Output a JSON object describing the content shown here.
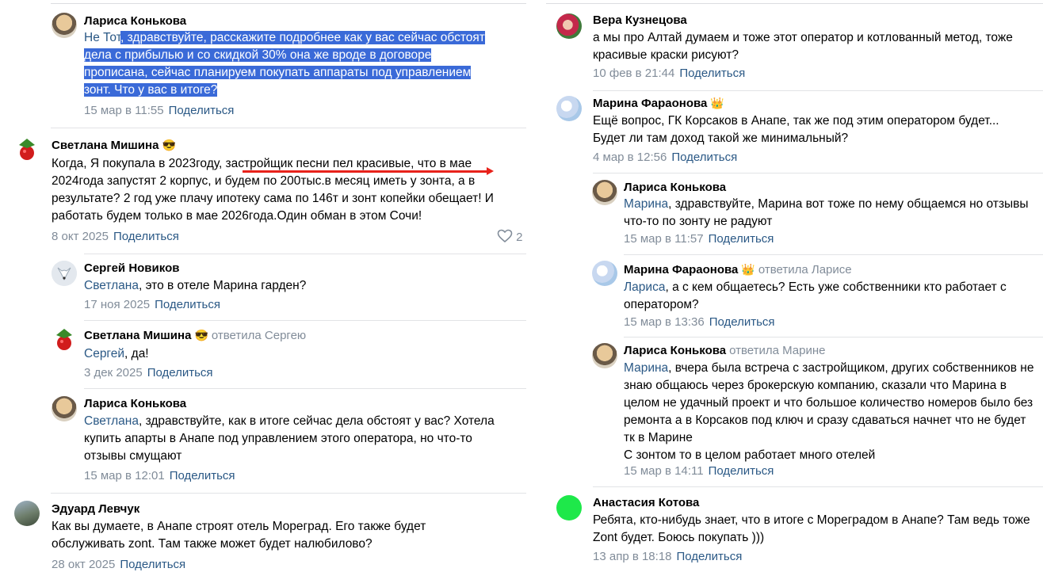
{
  "left": {
    "comments": [
      {
        "name": "Лариса Конькова",
        "mention": "Не Тот",
        "lines": [
          ", здравствуйте, расскажите подробнее как у вас сейчас обстоят",
          "дела с прибылью и со скидкой 30% она же вроде в договоре",
          "прописана, сейчас планируем покупать аппараты под управлением",
          "зонт. Что у вас в итоге?"
        ],
        "date": "15 мар в 11:55",
        "share": "Поделиться"
      },
      {
        "name": "Светлана Мишина",
        "emoji": "😎",
        "lines": [
          "Когда, Я покупала в 2023году, застройщик песни пел красивые, что в мае",
          "2024года запустят 2 корпус, и будем по 200тыс.в месяц иметь у зонта, а в",
          "результате? 2 год уже плачу ипотеку сама по 146т и зонт копейки обещает! И",
          "работать будем только в мае 2026года.Один обман в этом Сочи!"
        ],
        "date": "8 окт 2025",
        "share": "Поделиться",
        "likes": "2"
      },
      {
        "name": "Сергей Новиков",
        "mention": "Светлана",
        "lines": [
          ", это в отеле Марина гарден?"
        ],
        "date": "17 ноя 2025",
        "share": "Поделиться"
      },
      {
        "name": "Светлана Мишина",
        "emoji": "😎",
        "reply_to": "ответила Сергею",
        "mention": "Сергей",
        "lines": [
          ", да!"
        ],
        "date": "3 дек 2025",
        "share": "Поделиться"
      },
      {
        "name": "Лариса Конькова",
        "mention": "Светлана",
        "lines": [
          ", здравствуйте, как в итоге сейчас дела обстоят у вас? Хотела",
          "купить апарты в Анапе под управлением этого оператора, но что-то",
          "отзывы смущают"
        ],
        "date": "15 мар в 12:01",
        "share": "Поделиться"
      },
      {
        "name": "Эдуард Левчук",
        "lines": [
          "Как вы думаете, в Анапе строят отель Мореград. Его также будет",
          "обслуживать zont. Там также может будет налюбилово?"
        ],
        "date": "28 окт 2025",
        "share": "Поделиться"
      }
    ]
  },
  "right": {
    "comments": [
      {
        "name": "Вера Кузнецова",
        "lines": [
          "а мы про Алтай думаем и тоже этот оператор и котлованный метод, тоже",
          "красивые краски рисуют?"
        ],
        "date": "10 фев в 21:44",
        "share": "Поделиться"
      },
      {
        "name": "Марина Фараонова",
        "emoji": "👑",
        "lines": [
          "Ещё вопрос, ГК Корсаков в Анапе, так же под этим оператором будет...",
          "Будет ли там доход такой же минимальный?"
        ],
        "date": "4 мар в 12:56",
        "share": "Поделиться"
      },
      {
        "name": "Лариса Конькова",
        "mention": "Марина",
        "lines": [
          ", здравствуйте, Марина вот тоже по нему общаемся но отзывы",
          "что-то по зонту не радуют"
        ],
        "date": "15 мар в 11:57",
        "share": "Поделиться"
      },
      {
        "name": "Марина Фараонова",
        "emoji": "👑",
        "reply_to": "ответила Ларисе",
        "mention": "Лариса",
        "lines": [
          ", а с кем общаетесь? Есть уже собственники кто работает с",
          "оператором?"
        ],
        "date": "15 мар в 13:36",
        "share": "Поделиться"
      },
      {
        "name": "Лариса Конькова",
        "reply_to": "ответила Марине",
        "mention": "Марина",
        "lines": [
          ", вчера была встреча с застройщиком, других собственников не",
          "знаю общаюсь через брокерскую компанию, сказали что Марина в",
          "целом не удачный проект и что большое количество номеров было без",
          "ремонта а в Корсаков под ключ и сразу сдаваться начнет что не будет",
          "тк в Марине",
          "С зонтом то в целом работает много отелей"
        ],
        "date": "15 мар в 14:11",
        "share": "Поделиться"
      },
      {
        "name": "Анастасия Котова",
        "lines": [
          "Ребята, кто-нибудь знает, что в итоге с Мореградом в Анапе? Там ведь тоже",
          "Zont будет. Боюсь покупать )))"
        ],
        "date": "13 апр в 18:18",
        "share": "Поделиться"
      }
    ]
  },
  "colors": {
    "link": "#2a5885",
    "meta": "#818c99",
    "selection": "#3a6ad8",
    "annotation": "#e8221b",
    "avatar_green": "#1ee84a"
  },
  "icons": {
    "heart": "heart-icon"
  }
}
